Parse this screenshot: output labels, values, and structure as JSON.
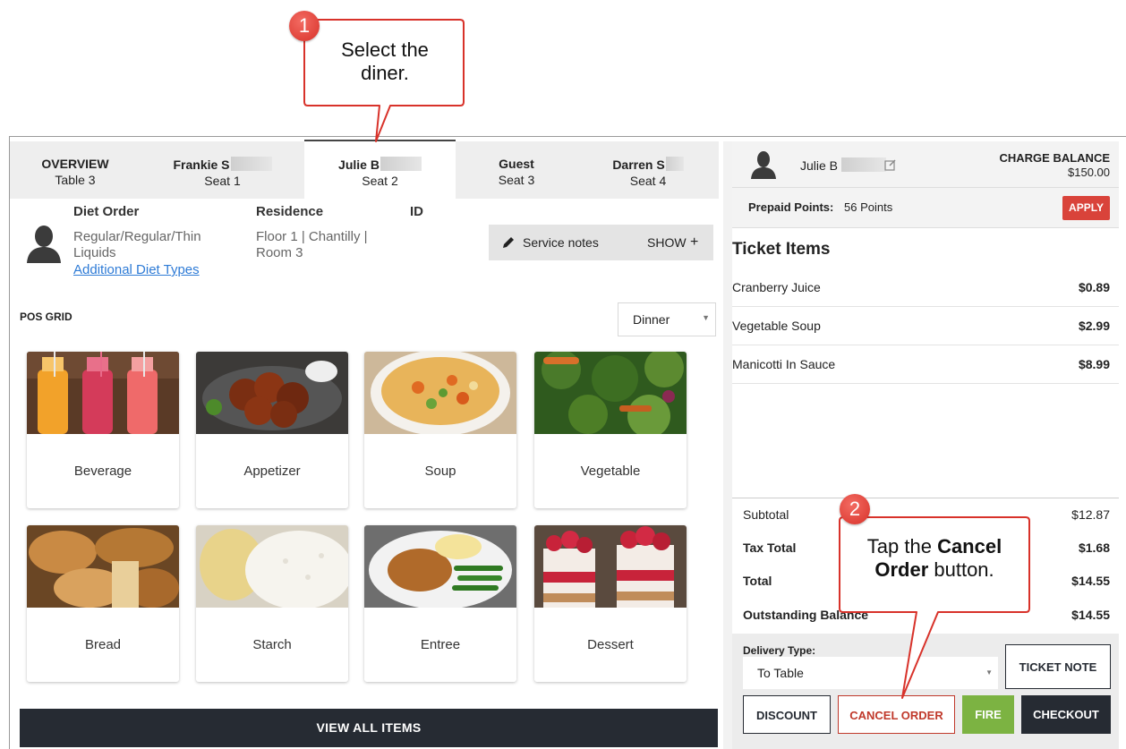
{
  "callouts": [
    {
      "number": "1",
      "text_line1": "Select the",
      "text_line2": "diner."
    },
    {
      "number": "2",
      "text_pre": "Tap the ",
      "text_bold1": "Cancel",
      "text_bold2": "Order",
      "text_post": " button."
    }
  ],
  "tabs": [
    {
      "name": "OVERVIEW",
      "sub": "Table 3"
    },
    {
      "name": "Frankie S",
      "sub": "Seat 1"
    },
    {
      "name": "Julie B",
      "sub": "Seat 2"
    },
    {
      "name": "Guest",
      "sub": "Seat 3"
    },
    {
      "name": "Darren S",
      "sub": "Seat 4"
    }
  ],
  "diet": {
    "order_label": "Diet Order",
    "order_line1": "Regular/Regular/Thin",
    "order_line2": "Liquids",
    "additional_link": "Additional Diet Types",
    "residence_label": "Residence",
    "residence_line1": "Floor 1 | Chantilly |",
    "residence_line2": "Room 3",
    "id_label": "ID"
  },
  "service_notes": {
    "label": "Service notes",
    "action": "SHOW",
    "plus": "+"
  },
  "pos": {
    "label": "POS GRID",
    "meal_selected": "Dinner",
    "categories": [
      "Beverage",
      "Appetizer",
      "Soup",
      "Vegetable",
      "Bread",
      "Starch",
      "Entree",
      "Dessert"
    ],
    "view_all": "VIEW ALL ITEMS"
  },
  "account": {
    "name": "Julie B",
    "charge_label": "CHARGE BALANCE",
    "charge_value": "$150.00",
    "prepaid_label": "Prepaid Points:",
    "prepaid_value": "56 Points",
    "apply": "APPLY"
  },
  "ticket": {
    "title": "Ticket Items",
    "items": [
      {
        "name": "Cranberry Juice",
        "price": "$0.89"
      },
      {
        "name": "Vegetable Soup",
        "price": "$2.99"
      },
      {
        "name": "Manicotti In Sauce",
        "price": "$8.99"
      }
    ]
  },
  "totals": {
    "subtotal_label": "Subtotal",
    "subtotal": "$12.87",
    "tax_label": "Tax Total",
    "tax": "$1.68",
    "total_label": "Total",
    "total": "$14.55",
    "outstanding_label": "Outstanding Balance",
    "outstanding": "$14.55"
  },
  "footer": {
    "delivery_label": "Delivery Type:",
    "delivery_value": "To Table",
    "ticket_note": "TICKET NOTE",
    "discount": "DISCOUNT",
    "cancel_order": "CANCEL ORDER",
    "fire": "FIRE",
    "checkout": "CHECKOUT"
  },
  "colors": {
    "dark": "#262b33",
    "red": "#d9433a",
    "green": "#7cb342",
    "callout_border": "#d8322a",
    "link": "#2e7bd6"
  }
}
